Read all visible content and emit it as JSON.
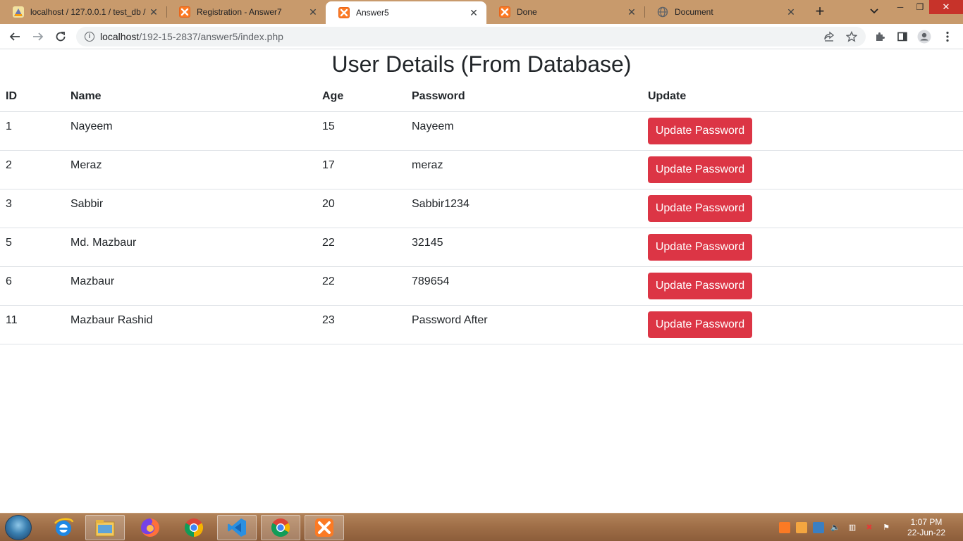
{
  "tabs": [
    {
      "title": "localhost / 127.0.0.1 / test_db /",
      "icon": "phpmyadmin-icon",
      "active": false
    },
    {
      "title": "Registration - Answer7",
      "icon": "xampp-icon",
      "active": false
    },
    {
      "title": "Answer5",
      "icon": "xampp-icon",
      "active": true
    },
    {
      "title": "Done",
      "icon": "xampp-icon",
      "active": false
    },
    {
      "title": "Document",
      "icon": "globe-icon",
      "active": false
    }
  ],
  "toolbar": {
    "url_host": "localhost",
    "url_path": "/192-15-2837/answer5/index.php"
  },
  "page": {
    "title": "User Details (From Database)"
  },
  "table": {
    "headers": [
      "ID",
      "Name",
      "Age",
      "Password",
      "Update"
    ],
    "rows": [
      {
        "id": "1",
        "name": "Nayeem",
        "age": "15",
        "password": "Nayeem",
        "button": "Update Password"
      },
      {
        "id": "2",
        "name": "Meraz",
        "age": "17",
        "password": "meraz",
        "button": "Update Password"
      },
      {
        "id": "3",
        "name": "Sabbir",
        "age": "20",
        "password": "Sabbir1234",
        "button": "Update Password"
      },
      {
        "id": "5",
        "name": "Md. Mazbaur",
        "age": "22",
        "password": "32145",
        "button": "Update Password"
      },
      {
        "id": "6",
        "name": "Mazbaur",
        "age": "22",
        "password": "789654",
        "button": "Update Password"
      },
      {
        "id": "11",
        "name": "Mazbaur Rashid",
        "age": "23",
        "password": "Password After",
        "button": "Update Password"
      }
    ]
  },
  "taskbar": {
    "apps": [
      "internet-explorer-icon",
      "file-explorer-icon",
      "firefox-icon",
      "chrome-icon",
      "vscode-icon",
      "chrome-icon",
      "xampp-icon"
    ],
    "clock_time": "1:07 PM",
    "clock_date": "22-Jun-22"
  },
  "colors": {
    "tabstrip": "#c89a6c",
    "button_danger": "#dc3545",
    "text": "#212529",
    "border": "#dee2e6"
  }
}
